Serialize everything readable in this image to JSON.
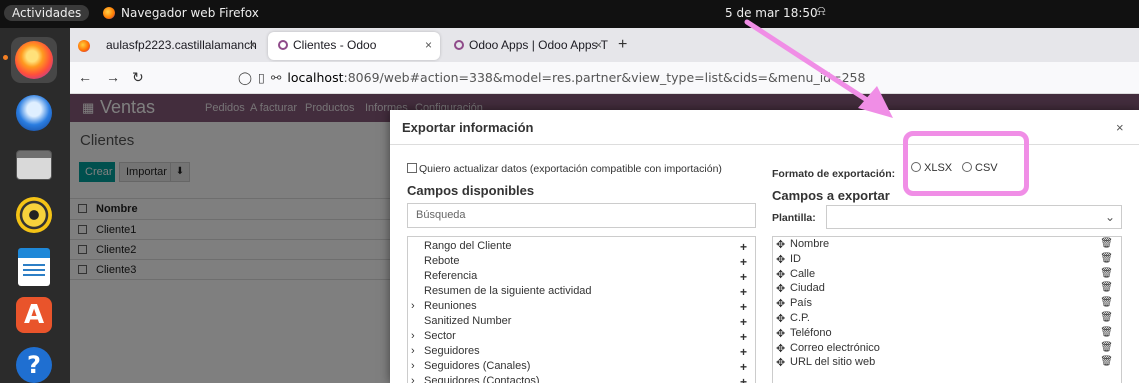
{
  "system": {
    "activities": "Actividades",
    "app_name": "Navegador web Firefox",
    "datetime": "5 de mar  18:50",
    "notification_glyph": "⍾"
  },
  "dock": {
    "items": [
      "firefox-icon",
      "thunderbird-icon",
      "files-icon",
      "rhythmbox-icon",
      "writer-icon",
      "software-icon",
      "help-icon"
    ]
  },
  "browser": {
    "tabs": [
      {
        "label": "aulasfp2223.castillalamanch"
      },
      {
        "label": "Clientes - Odoo"
      },
      {
        "label": "Odoo Apps | Odoo Apps T"
      }
    ],
    "close_glyph": "×",
    "new_tab_glyph": "+",
    "url_host": "localhost",
    "url_path": ":8069/web#action=338&model=res.partner&view_type=list&cids=&menu_id=258"
  },
  "odoo": {
    "app_title": "Ventas",
    "menu": [
      "Pedidos",
      "A facturar",
      "Productos",
      "Informes",
      "Configuración"
    ],
    "breadcrumb": "Clientes",
    "create_label": "Crear",
    "import_label": "Importar",
    "column_header": "Nombre",
    "rows": [
      "Cliente1",
      "Cliente2",
      "Cliente3"
    ]
  },
  "dialog": {
    "title": "Exportar información",
    "close_glyph": "×",
    "compat_label": "Quiero actualizar datos (exportación compatible con importación)",
    "available_heading": "Campos disponibles",
    "search_placeholder": "Búsqueda",
    "available_fields": [
      {
        "label": "Rango del Cliente",
        "expandable": false
      },
      {
        "label": "Rebote",
        "expandable": false
      },
      {
        "label": "Referencia",
        "expandable": false
      },
      {
        "label": "Resumen de la siguiente actividad",
        "expandable": false
      },
      {
        "label": "Reuniones",
        "expandable": true
      },
      {
        "label": "Sanitized Number",
        "expandable": false
      },
      {
        "label": "Sector",
        "expandable": true
      },
      {
        "label": "Seguidores",
        "expandable": true
      },
      {
        "label": "Seguidores (Canales)",
        "expandable": true
      },
      {
        "label": "Seguidores (Contactos)",
        "expandable": true
      }
    ],
    "format_label": "Formato de exportación:",
    "format_options": [
      "XLSX",
      "CSV"
    ],
    "export_heading": "Campos a exportar",
    "template_label": "Plantilla:",
    "export_fields": [
      "Nombre",
      "ID",
      "Calle",
      "Ciudad",
      "País",
      "C.P.",
      "Teléfono",
      "Correo electrónico",
      "URL del sitio web"
    ]
  },
  "annotation": {
    "color": "#f08ee6"
  }
}
